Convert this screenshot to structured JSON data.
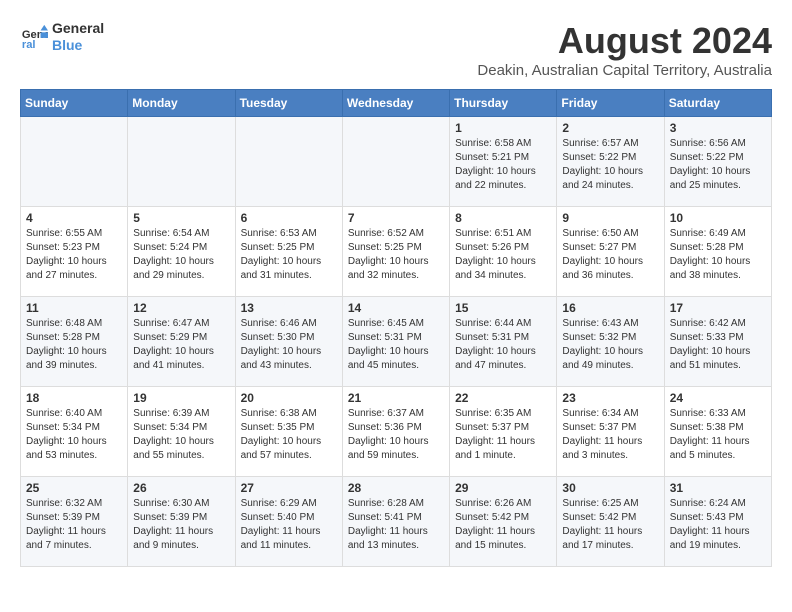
{
  "logo": {
    "line1": "General",
    "line2": "Blue"
  },
  "title": "August 2024",
  "subtitle": "Deakin, Australian Capital Territory, Australia",
  "weekdays": [
    "Sunday",
    "Monday",
    "Tuesday",
    "Wednesday",
    "Thursday",
    "Friday",
    "Saturday"
  ],
  "weeks": [
    [
      {
        "day": "",
        "info": ""
      },
      {
        "day": "",
        "info": ""
      },
      {
        "day": "",
        "info": ""
      },
      {
        "day": "",
        "info": ""
      },
      {
        "day": "1",
        "info": "Sunrise: 6:58 AM\nSunset: 5:21 PM\nDaylight: 10 hours\nand 22 minutes."
      },
      {
        "day": "2",
        "info": "Sunrise: 6:57 AM\nSunset: 5:22 PM\nDaylight: 10 hours\nand 24 minutes."
      },
      {
        "day": "3",
        "info": "Sunrise: 6:56 AM\nSunset: 5:22 PM\nDaylight: 10 hours\nand 25 minutes."
      }
    ],
    [
      {
        "day": "4",
        "info": "Sunrise: 6:55 AM\nSunset: 5:23 PM\nDaylight: 10 hours\nand 27 minutes."
      },
      {
        "day": "5",
        "info": "Sunrise: 6:54 AM\nSunset: 5:24 PM\nDaylight: 10 hours\nand 29 minutes."
      },
      {
        "day": "6",
        "info": "Sunrise: 6:53 AM\nSunset: 5:25 PM\nDaylight: 10 hours\nand 31 minutes."
      },
      {
        "day": "7",
        "info": "Sunrise: 6:52 AM\nSunset: 5:25 PM\nDaylight: 10 hours\nand 32 minutes."
      },
      {
        "day": "8",
        "info": "Sunrise: 6:51 AM\nSunset: 5:26 PM\nDaylight: 10 hours\nand 34 minutes."
      },
      {
        "day": "9",
        "info": "Sunrise: 6:50 AM\nSunset: 5:27 PM\nDaylight: 10 hours\nand 36 minutes."
      },
      {
        "day": "10",
        "info": "Sunrise: 6:49 AM\nSunset: 5:28 PM\nDaylight: 10 hours\nand 38 minutes."
      }
    ],
    [
      {
        "day": "11",
        "info": "Sunrise: 6:48 AM\nSunset: 5:28 PM\nDaylight: 10 hours\nand 39 minutes."
      },
      {
        "day": "12",
        "info": "Sunrise: 6:47 AM\nSunset: 5:29 PM\nDaylight: 10 hours\nand 41 minutes."
      },
      {
        "day": "13",
        "info": "Sunrise: 6:46 AM\nSunset: 5:30 PM\nDaylight: 10 hours\nand 43 minutes."
      },
      {
        "day": "14",
        "info": "Sunrise: 6:45 AM\nSunset: 5:31 PM\nDaylight: 10 hours\nand 45 minutes."
      },
      {
        "day": "15",
        "info": "Sunrise: 6:44 AM\nSunset: 5:31 PM\nDaylight: 10 hours\nand 47 minutes."
      },
      {
        "day": "16",
        "info": "Sunrise: 6:43 AM\nSunset: 5:32 PM\nDaylight: 10 hours\nand 49 minutes."
      },
      {
        "day": "17",
        "info": "Sunrise: 6:42 AM\nSunset: 5:33 PM\nDaylight: 10 hours\nand 51 minutes."
      }
    ],
    [
      {
        "day": "18",
        "info": "Sunrise: 6:40 AM\nSunset: 5:34 PM\nDaylight: 10 hours\nand 53 minutes."
      },
      {
        "day": "19",
        "info": "Sunrise: 6:39 AM\nSunset: 5:34 PM\nDaylight: 10 hours\nand 55 minutes."
      },
      {
        "day": "20",
        "info": "Sunrise: 6:38 AM\nSunset: 5:35 PM\nDaylight: 10 hours\nand 57 minutes."
      },
      {
        "day": "21",
        "info": "Sunrise: 6:37 AM\nSunset: 5:36 PM\nDaylight: 10 hours\nand 59 minutes."
      },
      {
        "day": "22",
        "info": "Sunrise: 6:35 AM\nSunset: 5:37 PM\nDaylight: 11 hours\nand 1 minute."
      },
      {
        "day": "23",
        "info": "Sunrise: 6:34 AM\nSunset: 5:37 PM\nDaylight: 11 hours\nand 3 minutes."
      },
      {
        "day": "24",
        "info": "Sunrise: 6:33 AM\nSunset: 5:38 PM\nDaylight: 11 hours\nand 5 minutes."
      }
    ],
    [
      {
        "day": "25",
        "info": "Sunrise: 6:32 AM\nSunset: 5:39 PM\nDaylight: 11 hours\nand 7 minutes."
      },
      {
        "day": "26",
        "info": "Sunrise: 6:30 AM\nSunset: 5:39 PM\nDaylight: 11 hours\nand 9 minutes."
      },
      {
        "day": "27",
        "info": "Sunrise: 6:29 AM\nSunset: 5:40 PM\nDaylight: 11 hours\nand 11 minutes."
      },
      {
        "day": "28",
        "info": "Sunrise: 6:28 AM\nSunset: 5:41 PM\nDaylight: 11 hours\nand 13 minutes."
      },
      {
        "day": "29",
        "info": "Sunrise: 6:26 AM\nSunset: 5:42 PM\nDaylight: 11 hours\nand 15 minutes."
      },
      {
        "day": "30",
        "info": "Sunrise: 6:25 AM\nSunset: 5:42 PM\nDaylight: 11 hours\nand 17 minutes."
      },
      {
        "day": "31",
        "info": "Sunrise: 6:24 AM\nSunset: 5:43 PM\nDaylight: 11 hours\nand 19 minutes."
      }
    ]
  ]
}
